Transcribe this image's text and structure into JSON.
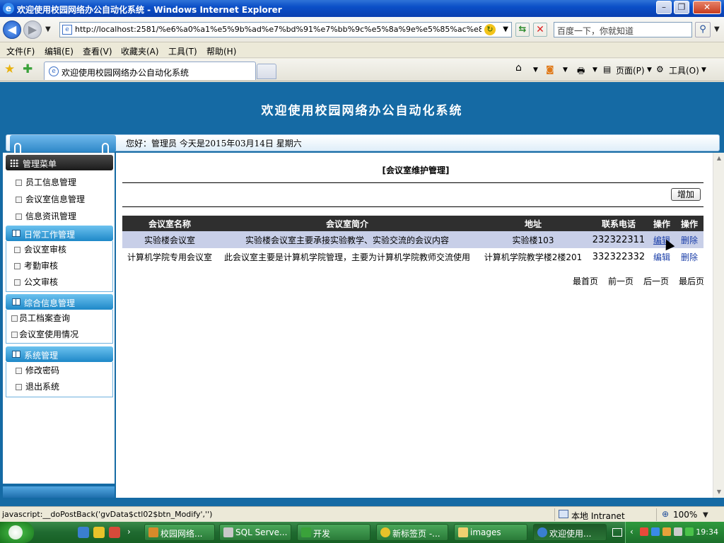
{
  "browser": {
    "window_title": "欢迎使用校园网络办公自动化系统 - Windows Internet Explorer",
    "url": "http://localhost:2581/%e6%a0%a1%e5%9b%ad%e7%bd%91%e7%bb%9c%e5%8a%9e%e5%85%ac%e8%87%",
    "search_placeholder": "百度一下，你就知道",
    "menu": [
      "文件(F)",
      "编辑(E)",
      "查看(V)",
      "收藏夹(A)",
      "工具(T)",
      "帮助(H)"
    ],
    "tab_title": "欢迎使用校园网络办公自动化系统",
    "page_menu": "页面(P)",
    "tools_menu": "工具(O)",
    "status_text": "javascript:__doPostBack('gvData$ctl02$btn_Modify','')",
    "zone": "本地 Intranet",
    "zoom": "100%"
  },
  "page": {
    "heading": "欢迎使用校园网络办公自动化系统",
    "greeting": "您好：管理员    今天是2015年03月14日    星期六"
  },
  "sidebar": {
    "menu_title": "管理菜单",
    "top_items": [
      "员工信息管理",
      "会议室信息管理",
      "信息资讯管理"
    ],
    "sections": [
      {
        "title": "日常工作管理",
        "items": [
          "会议室审核",
          "考勤审核",
          "公文审核"
        ]
      },
      {
        "title": "综合信息管理",
        "items": [
          "员工档案查询",
          "会议室使用情况"
        ]
      },
      {
        "title": "系统管理",
        "items": [
          "修改密码",
          "退出系统"
        ]
      }
    ]
  },
  "main": {
    "title": "[会议室维护管理]",
    "add_button": "增加",
    "columns": [
      "会议室名称",
      "会议室简介",
      "地址",
      "联系电话",
      "操作",
      "操作"
    ],
    "rows": [
      {
        "name": "实验楼会议室",
        "intro": "实验楼会议室主要承接实验教学、实验交流的会议内容",
        "address": "实验楼103",
        "phone": "232322311",
        "edit": "编辑",
        "delete": "删除"
      },
      {
        "name": "计算机学院专用会议室",
        "intro": "此会议室主要是计算机学院管理，主要为计算机学院教师交流使用",
        "address": "计算机学院教学楼2楼201",
        "phone": "332322332",
        "edit": "编辑",
        "delete": "删除"
      }
    ],
    "pager": [
      "最首页",
      "前一页",
      "后一页",
      "最后页"
    ]
  },
  "taskbar": {
    "buttons": [
      "校园网络...",
      "SQL Serve...",
      "开发",
      "新标签页 -...",
      "images",
      "欢迎使用..."
    ],
    "time": "19:34"
  }
}
